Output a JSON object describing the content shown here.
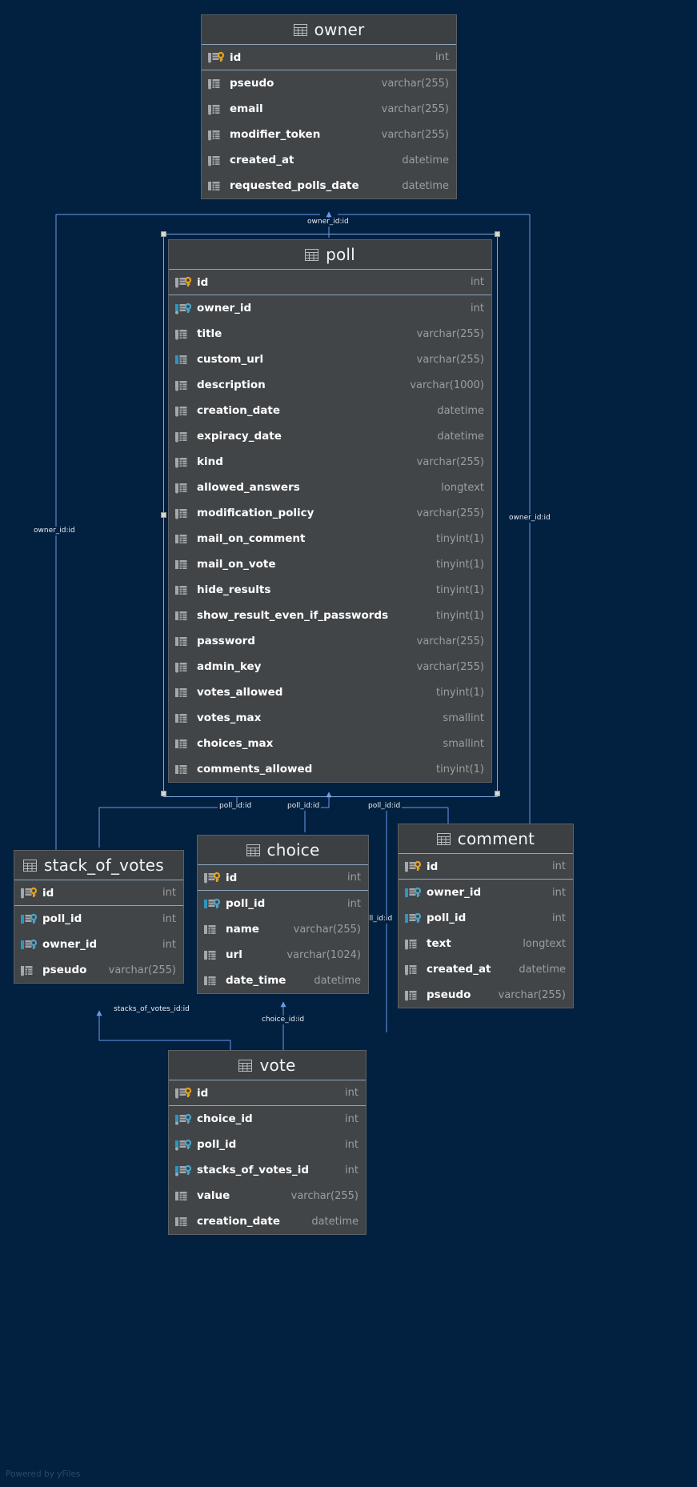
{
  "diagram": {
    "background_color": "#02203f",
    "node_fill": "#414548",
    "edge_color": "#6b9ae8",
    "watermark": "Powered by yFiles",
    "pk_key_color": "#e8a317",
    "fk_key_color": "#4ba6c9",
    "index_bar_color": "#2f94c0"
  },
  "tables": [
    {
      "name": "owner",
      "icon": "table-icon",
      "columns": [
        {
          "name": "id",
          "type": "int",
          "icon": "primary-key-icon"
        },
        {
          "name": "pseudo",
          "type": "varchar(255)",
          "icon": "column-icon"
        },
        {
          "name": "email",
          "type": "varchar(255)",
          "icon": "column-icon"
        },
        {
          "name": "modifier_token",
          "type": "varchar(255)",
          "icon": "column-icon"
        },
        {
          "name": "created_at",
          "type": "datetime",
          "icon": "column-icon"
        },
        {
          "name": "requested_polls_date",
          "type": "datetime",
          "icon": "column-indexed-icon"
        }
      ]
    },
    {
      "name": "poll",
      "icon": "table-icon",
      "columns": [
        {
          "name": "id",
          "type": "int",
          "icon": "primary-key-icon"
        },
        {
          "name": "owner_id",
          "type": "int",
          "icon": "foreign-key-icon"
        },
        {
          "name": "title",
          "type": "varchar(255)",
          "icon": "column-icon"
        },
        {
          "name": "custom_url",
          "type": "varchar(255)",
          "icon": "column-indexed-icon"
        },
        {
          "name": "description",
          "type": "varchar(1000)",
          "icon": "column-icon"
        },
        {
          "name": "creation_date",
          "type": "datetime",
          "icon": "column-icon"
        },
        {
          "name": "expiracy_date",
          "type": "datetime",
          "icon": "column-icon"
        },
        {
          "name": "kind",
          "type": "varchar(255)",
          "icon": "column-icon"
        },
        {
          "name": "allowed_answers",
          "type": "longtext",
          "icon": "column-icon"
        },
        {
          "name": "modification_policy",
          "type": "varchar(255)",
          "icon": "column-icon"
        },
        {
          "name": "mail_on_comment",
          "type": "tinyint(1)",
          "icon": "column-indexed-icon"
        },
        {
          "name": "mail_on_vote",
          "type": "tinyint(1)",
          "icon": "column-indexed-icon"
        },
        {
          "name": "hide_results",
          "type": "tinyint(1)",
          "icon": "column-indexed-icon"
        },
        {
          "name": "show_result_even_if_passwords",
          "type": "tinyint(1)",
          "icon": "column-indexed-icon"
        },
        {
          "name": "password",
          "type": "varchar(255)",
          "icon": "column-indexed-icon"
        },
        {
          "name": "admin_key",
          "type": "varchar(255)",
          "icon": "column-icon"
        },
        {
          "name": "votes_allowed",
          "type": "tinyint(1)",
          "icon": "column-indexed-icon"
        },
        {
          "name": "votes_max",
          "type": "smallint",
          "icon": "column-indexed-icon"
        },
        {
          "name": "choices_max",
          "type": "smallint",
          "icon": "column-indexed-icon"
        },
        {
          "name": "comments_allowed",
          "type": "tinyint(1)",
          "icon": "column-indexed-icon"
        }
      ]
    },
    {
      "name": "stack_of_votes",
      "icon": "table-icon",
      "columns": [
        {
          "name": "id",
          "type": "int",
          "icon": "primary-key-icon"
        },
        {
          "name": "poll_id",
          "type": "int",
          "icon": "foreign-key-icon"
        },
        {
          "name": "owner_id",
          "type": "int",
          "icon": "foreign-key-icon"
        },
        {
          "name": "pseudo",
          "type": "varchar(255)",
          "icon": "column-icon"
        }
      ]
    },
    {
      "name": "choice",
      "icon": "table-icon",
      "columns": [
        {
          "name": "id",
          "type": "int",
          "icon": "primary-key-icon"
        },
        {
          "name": "poll_id",
          "type": "int",
          "icon": "foreign-key-icon"
        },
        {
          "name": "name",
          "type": "varchar(255)",
          "icon": "column-indexed-icon"
        },
        {
          "name": "url",
          "type": "varchar(1024)",
          "icon": "column-indexed-icon"
        },
        {
          "name": "date_time",
          "type": "datetime",
          "icon": "column-indexed-icon"
        }
      ]
    },
    {
      "name": "comment",
      "icon": "table-icon",
      "columns": [
        {
          "name": "id",
          "type": "int",
          "icon": "primary-key-icon"
        },
        {
          "name": "owner_id",
          "type": "int",
          "icon": "foreign-key-icon"
        },
        {
          "name": "poll_id",
          "type": "int",
          "icon": "foreign-key-icon"
        },
        {
          "name": "text",
          "type": "longtext",
          "icon": "column-icon"
        },
        {
          "name": "created_at",
          "type": "datetime",
          "icon": "column-icon"
        },
        {
          "name": "pseudo",
          "type": "varchar(255)",
          "icon": "column-icon"
        }
      ]
    },
    {
      "name": "vote",
      "icon": "table-icon",
      "columns": [
        {
          "name": "id",
          "type": "int",
          "icon": "primary-key-icon"
        },
        {
          "name": "choice_id",
          "type": "int",
          "icon": "foreign-key-icon"
        },
        {
          "name": "poll_id",
          "type": "int",
          "icon": "foreign-key-icon"
        },
        {
          "name": "stacks_of_votes_id",
          "type": "int",
          "icon": "foreign-key-icon"
        },
        {
          "name": "value",
          "type": "varchar(255)",
          "icon": "column-icon"
        },
        {
          "name": "creation_date",
          "type": "datetime",
          "icon": "column-icon"
        }
      ]
    }
  ],
  "edges": [
    {
      "label": "owner_id:id",
      "from": "poll",
      "to": "owner"
    },
    {
      "label": "owner_id:id",
      "from": "stack_of_votes",
      "to": "owner"
    },
    {
      "label": "owner_id:id",
      "from": "comment",
      "to": "owner"
    },
    {
      "label": "poll_id:id",
      "from": "stack_of_votes",
      "to": "poll"
    },
    {
      "label": "poll_id:id",
      "from": "choice",
      "to": "poll"
    },
    {
      "label": "poll_id:id",
      "from": "vote",
      "to": "poll"
    },
    {
      "label": "poll_id:id",
      "from": "comment",
      "to": "poll"
    },
    {
      "label": "stacks_of_votes_id:id",
      "from": "vote",
      "to": "stack_of_votes"
    },
    {
      "label": "choice_id:id",
      "from": "vote",
      "to": "choice"
    }
  ]
}
